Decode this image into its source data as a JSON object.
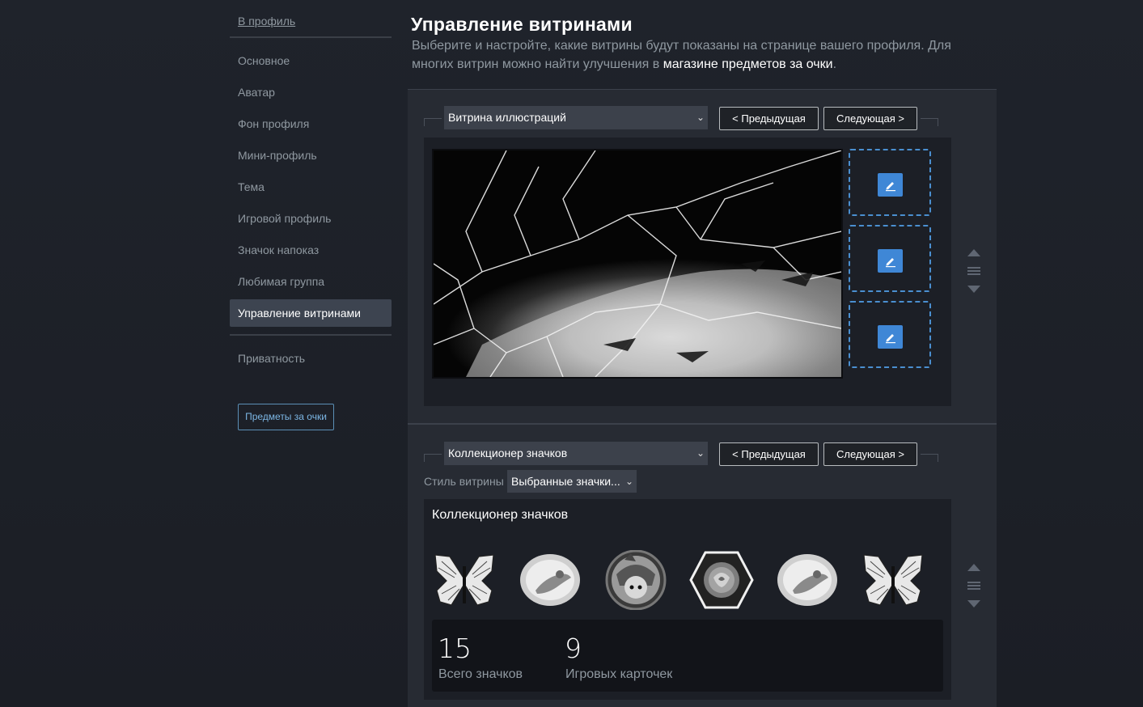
{
  "sidebar": {
    "back_link": "В профиль",
    "items": [
      {
        "label": "Основное"
      },
      {
        "label": "Аватар"
      },
      {
        "label": "Фон профиля"
      },
      {
        "label": "Мини-профиль"
      },
      {
        "label": "Тема"
      },
      {
        "label": "Игровой профиль"
      },
      {
        "label": "Значок напоказ"
      },
      {
        "label": "Любимая группа"
      },
      {
        "label": "Управление витринами",
        "active": true
      },
      {
        "label": "Приватность"
      }
    ],
    "points_button": "Предметы за очки"
  },
  "header": {
    "title": "Управление витринами",
    "desc_part1": "Выберите и настройте, какие витрины будут показаны на странице вашего профиля. Для многих витрин можно найти улучшения в ",
    "desc_link": "магазине предметов за очки",
    "desc_part2": "."
  },
  "showcase1": {
    "select_value": "Витрина иллюстраций",
    "prev_label": "< Предыдущая",
    "next_label": "Следующая >",
    "slot_icon": "pencil-icon"
  },
  "showcase2": {
    "select_value": "Коллекционер значков",
    "prev_label": "< Предыдущая",
    "next_label": "Следующая >",
    "style_label": "Стиль витрины",
    "style_value": "Выбранные значки...",
    "panel_title": "Коллекционер значков",
    "badges": [
      "butterfly-badge",
      "fairy-badge",
      "character-badge",
      "rose-badge",
      "fairy-badge",
      "butterfly-badge"
    ],
    "stats": [
      {
        "value": "15",
        "label": "Всего значков"
      },
      {
        "value": "9",
        "label": "Игровых карточек"
      }
    ]
  },
  "colors": {
    "accent": "#3f87d6",
    "background": "#1b1e25",
    "panel": "#272b33"
  }
}
